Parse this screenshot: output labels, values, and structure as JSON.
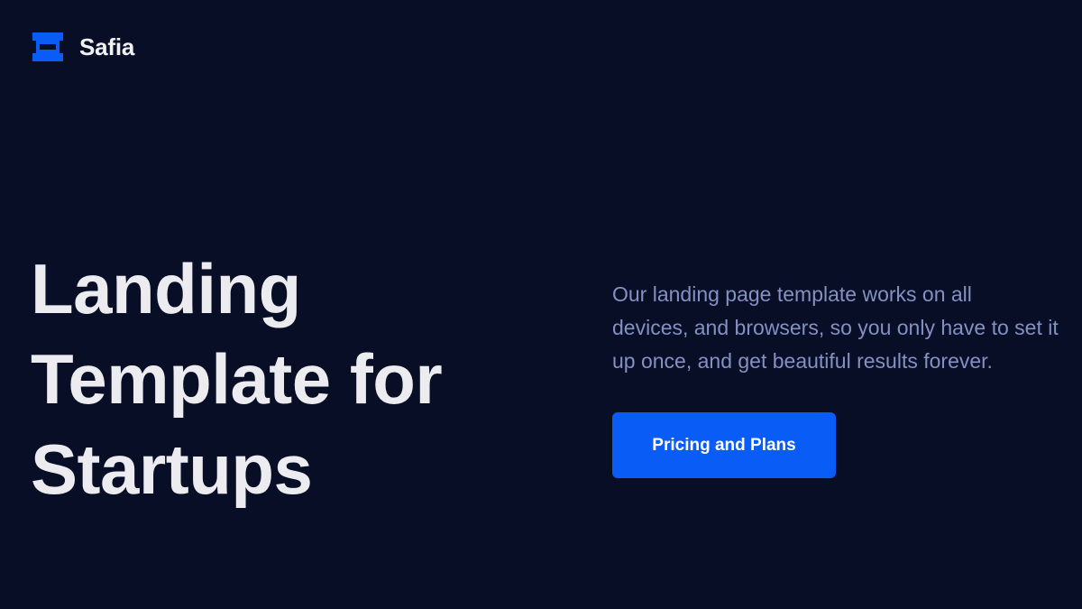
{
  "header": {
    "brand_name": "Safia",
    "logo_icon": "ticket-icon"
  },
  "hero": {
    "title_lines": [
      "Landing",
      "Template for",
      "Startups"
    ],
    "description_lines": [
      "Our landing page template works on all",
      "devices, and browsers, so you only have to set it",
      "up once, and get beautiful results forever."
    ],
    "cta_label": "Pricing and Plans"
  },
  "colors": {
    "background": "#070e26",
    "accent": "#0a5cf6",
    "heading": "#ececf0",
    "body_text": "#8590c3"
  }
}
